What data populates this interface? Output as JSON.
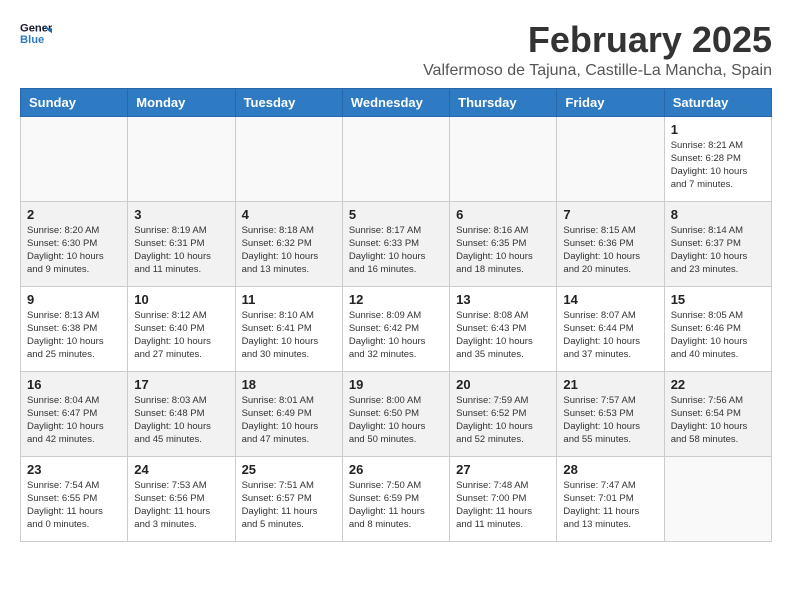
{
  "header": {
    "logo_line1": "General",
    "logo_line2": "Blue",
    "month_title": "February 2025",
    "location": "Valfermoso de Tajuna, Castille-La Mancha, Spain"
  },
  "weekdays": [
    "Sunday",
    "Monday",
    "Tuesday",
    "Wednesday",
    "Thursday",
    "Friday",
    "Saturday"
  ],
  "weeks": [
    [
      {
        "day": "",
        "info": ""
      },
      {
        "day": "",
        "info": ""
      },
      {
        "day": "",
        "info": ""
      },
      {
        "day": "",
        "info": ""
      },
      {
        "day": "",
        "info": ""
      },
      {
        "day": "",
        "info": ""
      },
      {
        "day": "1",
        "info": "Sunrise: 8:21 AM\nSunset: 6:28 PM\nDaylight: 10 hours and 7 minutes."
      }
    ],
    [
      {
        "day": "2",
        "info": "Sunrise: 8:20 AM\nSunset: 6:30 PM\nDaylight: 10 hours and 9 minutes."
      },
      {
        "day": "3",
        "info": "Sunrise: 8:19 AM\nSunset: 6:31 PM\nDaylight: 10 hours and 11 minutes."
      },
      {
        "day": "4",
        "info": "Sunrise: 8:18 AM\nSunset: 6:32 PM\nDaylight: 10 hours and 13 minutes."
      },
      {
        "day": "5",
        "info": "Sunrise: 8:17 AM\nSunset: 6:33 PM\nDaylight: 10 hours and 16 minutes."
      },
      {
        "day": "6",
        "info": "Sunrise: 8:16 AM\nSunset: 6:35 PM\nDaylight: 10 hours and 18 minutes."
      },
      {
        "day": "7",
        "info": "Sunrise: 8:15 AM\nSunset: 6:36 PM\nDaylight: 10 hours and 20 minutes."
      },
      {
        "day": "8",
        "info": "Sunrise: 8:14 AM\nSunset: 6:37 PM\nDaylight: 10 hours and 23 minutes."
      }
    ],
    [
      {
        "day": "9",
        "info": "Sunrise: 8:13 AM\nSunset: 6:38 PM\nDaylight: 10 hours and 25 minutes."
      },
      {
        "day": "10",
        "info": "Sunrise: 8:12 AM\nSunset: 6:40 PM\nDaylight: 10 hours and 27 minutes."
      },
      {
        "day": "11",
        "info": "Sunrise: 8:10 AM\nSunset: 6:41 PM\nDaylight: 10 hours and 30 minutes."
      },
      {
        "day": "12",
        "info": "Sunrise: 8:09 AM\nSunset: 6:42 PM\nDaylight: 10 hours and 32 minutes."
      },
      {
        "day": "13",
        "info": "Sunrise: 8:08 AM\nSunset: 6:43 PM\nDaylight: 10 hours and 35 minutes."
      },
      {
        "day": "14",
        "info": "Sunrise: 8:07 AM\nSunset: 6:44 PM\nDaylight: 10 hours and 37 minutes."
      },
      {
        "day": "15",
        "info": "Sunrise: 8:05 AM\nSunset: 6:46 PM\nDaylight: 10 hours and 40 minutes."
      }
    ],
    [
      {
        "day": "16",
        "info": "Sunrise: 8:04 AM\nSunset: 6:47 PM\nDaylight: 10 hours and 42 minutes."
      },
      {
        "day": "17",
        "info": "Sunrise: 8:03 AM\nSunset: 6:48 PM\nDaylight: 10 hours and 45 minutes."
      },
      {
        "day": "18",
        "info": "Sunrise: 8:01 AM\nSunset: 6:49 PM\nDaylight: 10 hours and 47 minutes."
      },
      {
        "day": "19",
        "info": "Sunrise: 8:00 AM\nSunset: 6:50 PM\nDaylight: 10 hours and 50 minutes."
      },
      {
        "day": "20",
        "info": "Sunrise: 7:59 AM\nSunset: 6:52 PM\nDaylight: 10 hours and 52 minutes."
      },
      {
        "day": "21",
        "info": "Sunrise: 7:57 AM\nSunset: 6:53 PM\nDaylight: 10 hours and 55 minutes."
      },
      {
        "day": "22",
        "info": "Sunrise: 7:56 AM\nSunset: 6:54 PM\nDaylight: 10 hours and 58 minutes."
      }
    ],
    [
      {
        "day": "23",
        "info": "Sunrise: 7:54 AM\nSunset: 6:55 PM\nDaylight: 11 hours and 0 minutes."
      },
      {
        "day": "24",
        "info": "Sunrise: 7:53 AM\nSunset: 6:56 PM\nDaylight: 11 hours and 3 minutes."
      },
      {
        "day": "25",
        "info": "Sunrise: 7:51 AM\nSunset: 6:57 PM\nDaylight: 11 hours and 5 minutes."
      },
      {
        "day": "26",
        "info": "Sunrise: 7:50 AM\nSunset: 6:59 PM\nDaylight: 11 hours and 8 minutes."
      },
      {
        "day": "27",
        "info": "Sunrise: 7:48 AM\nSunset: 7:00 PM\nDaylight: 11 hours and 11 minutes."
      },
      {
        "day": "28",
        "info": "Sunrise: 7:47 AM\nSunset: 7:01 PM\nDaylight: 11 hours and 13 minutes."
      },
      {
        "day": "",
        "info": ""
      }
    ]
  ]
}
